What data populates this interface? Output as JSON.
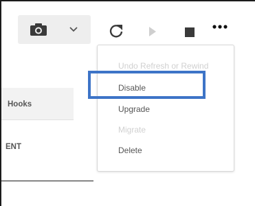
{
  "toolbar": {
    "camera_icon": "camera-icon",
    "dropdown_icon": "chevron-down-icon",
    "refresh_icon": "refresh-icon",
    "play_icon": "play-icon",
    "stop_icon": "stop-icon",
    "more_icon": "more-horizontal-icon"
  },
  "sidebar": {
    "tab_label": "Hooks",
    "section_label": "ENT"
  },
  "menu": {
    "items": [
      {
        "label": "Undo Refresh or Rewind",
        "enabled": false
      },
      {
        "label": "Disable",
        "enabled": true,
        "highlighted": true
      },
      {
        "label": "Upgrade",
        "enabled": true
      },
      {
        "label": "Migrate",
        "enabled": false
      },
      {
        "label": "Delete",
        "enabled": true
      }
    ]
  },
  "colors": {
    "highlight": "#3d74c7",
    "disabled_text": "#d0d0d0",
    "text": "#555555"
  }
}
